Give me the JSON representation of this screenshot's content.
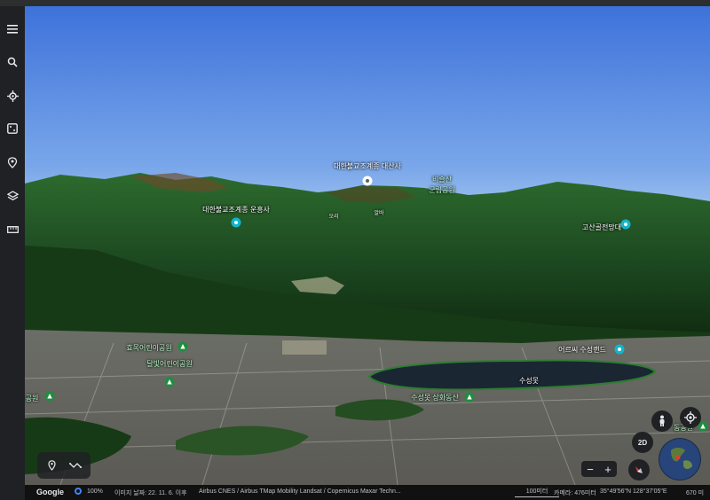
{
  "sidebar": {
    "icons": [
      "menu-icon",
      "search-icon",
      "voyager-icon",
      "dice-icon",
      "projects-icon",
      "layers-icon",
      "measure-icon"
    ]
  },
  "map": {
    "labels": {
      "temple_top": "대한불교조계종 대산사",
      "park_right_line1": "비슬산",
      "park_right_line2": "군립공원",
      "temple_left": "대한불교조계종 운흥사",
      "tiny_1": "오리",
      "tiny_2": "알바",
      "observatory": "고산골전망대",
      "children_park_1": "효목어린이공원",
      "children_park_2": "달빛어린이공원",
      "park_left_edge": "공원",
      "sunset_land": "어르씨 수성랜드",
      "suseong_lake": "수성못",
      "suseong_park": "수성못 상화동산",
      "right_edge_label": "동공원"
    }
  },
  "controls": {
    "two_d_label": "2D",
    "zoom_out": "−",
    "zoom_in": "+"
  },
  "statusbar": {
    "logo": "Google",
    "zoom_level": "100%",
    "image_date": "이미지 날짜: 22. 11. 6. 이후",
    "attribution": "Airbus   CNES / Airbus   TMap Mobility   Landsat / Copernicus   Maxar Techn...",
    "scale": "100미터",
    "camera": "카메라: 476미터",
    "coords": "35°49'56\"N 128°37'05\"E",
    "elevation": "670 미"
  },
  "colors": {
    "sky_top": "#3f74dc",
    "sky_horizon": "#a9c8ef",
    "forest": "#1f4a22",
    "lake": "#1d2a36",
    "ui_bg": "#202124"
  }
}
